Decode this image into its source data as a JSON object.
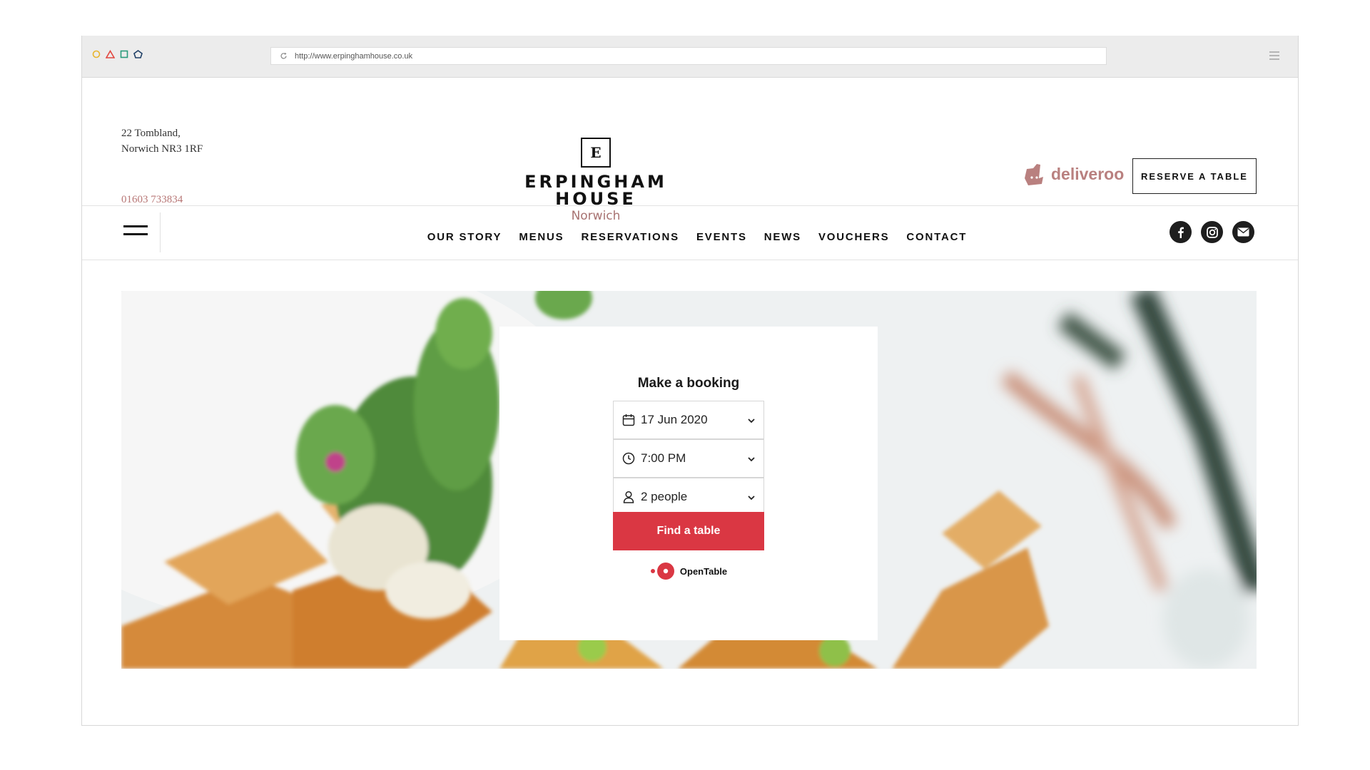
{
  "browser": {
    "url": "http://www.erpinghamhouse.co.uk"
  },
  "header": {
    "address_line1": "22 Tombland,",
    "address_line2": "Norwich NR3 1RF",
    "phone": "01603 733834",
    "logo_letter": "E",
    "logo_line1": "ERPINGHAM",
    "logo_line2": "HOUSE",
    "logo_city": "Norwich",
    "deliveroo_label": "deliveroo",
    "reserve_button": "RESERVE A TABLE"
  },
  "nav": {
    "items": [
      {
        "label": "OUR STORY"
      },
      {
        "label": "MENUS"
      },
      {
        "label": "RESERVATIONS"
      },
      {
        "label": "EVENTS"
      },
      {
        "label": "NEWS"
      },
      {
        "label": "VOUCHERS"
      },
      {
        "label": "CONTACT"
      }
    ],
    "socials": [
      "facebook-icon",
      "instagram-icon",
      "mail-icon"
    ]
  },
  "booking": {
    "title": "Make a booking",
    "date": "17 Jun 2020",
    "time": "7:00 PM",
    "party": "2 people",
    "button": "Find a table",
    "provider": "OpenTable"
  },
  "colors": {
    "accent": "#da3743",
    "brand_rose": "#a87372",
    "deliveroo": "#b9807f"
  }
}
